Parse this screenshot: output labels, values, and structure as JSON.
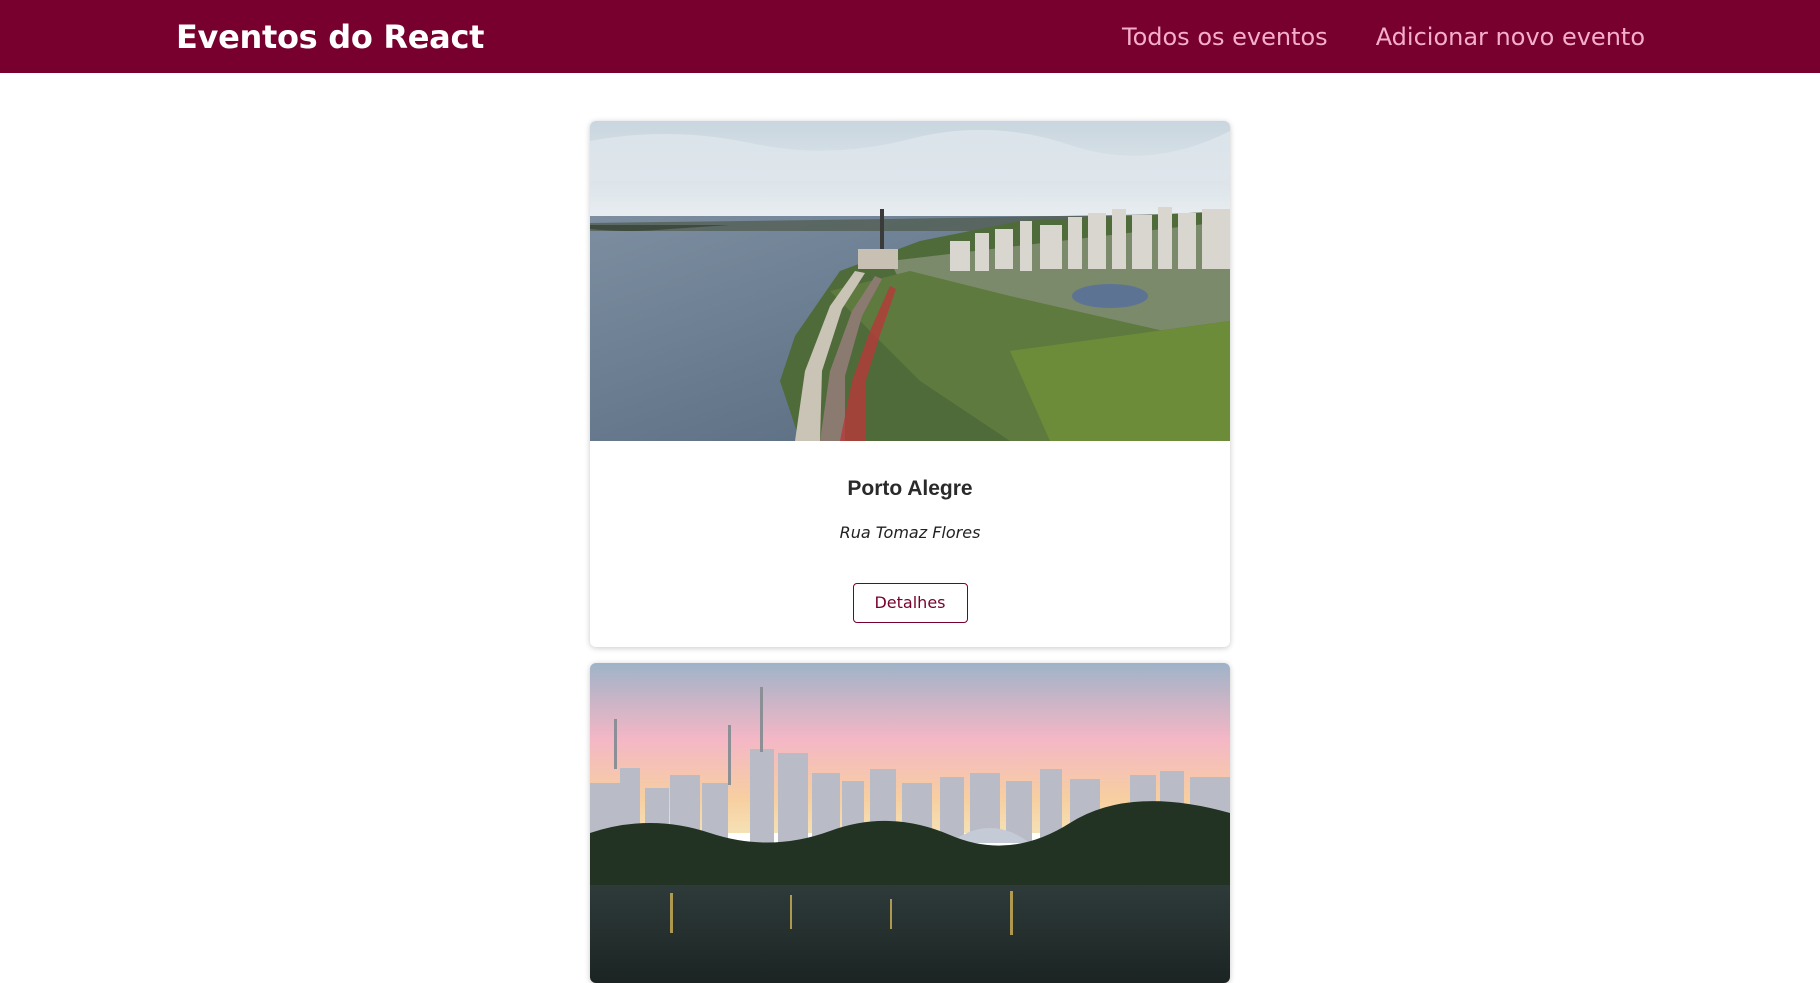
{
  "header": {
    "logo": "Eventos do React",
    "nav": [
      {
        "label": "Todos os eventos"
      },
      {
        "label": "Adicionar novo evento"
      }
    ]
  },
  "events": [
    {
      "title": "Porto Alegre",
      "address": "Rua Tomaz Flores",
      "button_label": "Detalhes",
      "image": "porto-alegre-aerial-photo"
    },
    {
      "image": "sao-paulo-skyline-photo"
    }
  ],
  "colors": {
    "brand": "#77002e",
    "nav_link": "#fcb8d2"
  }
}
